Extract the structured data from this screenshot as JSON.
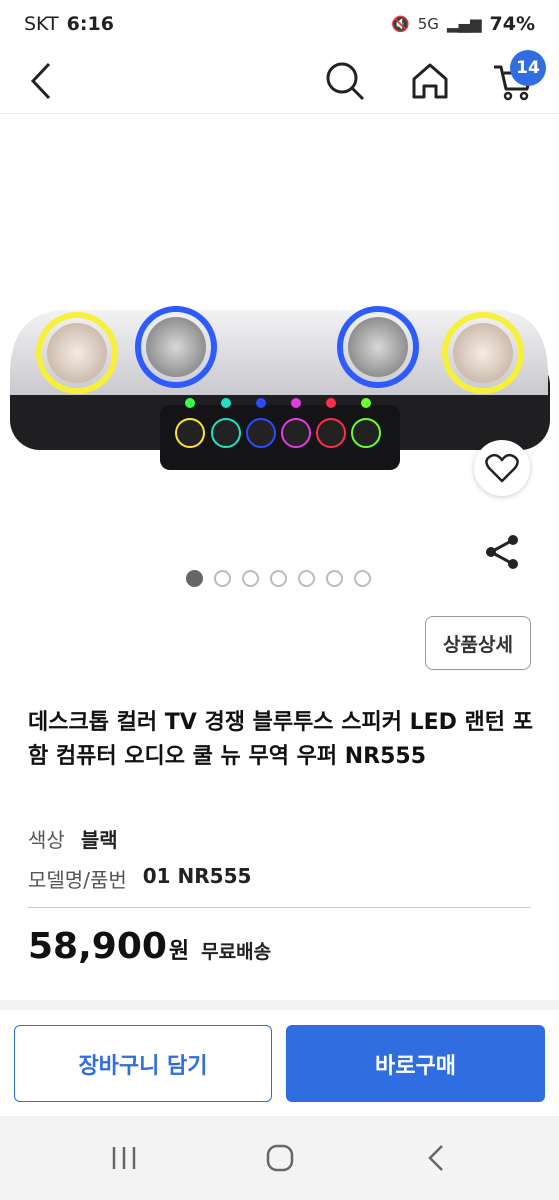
{
  "status": {
    "carrier": "SKT",
    "time": "6:16",
    "battery": "74%"
  },
  "nav": {
    "cart_count": "14"
  },
  "gallery": {
    "total": 7,
    "active": 0
  },
  "product": {
    "detail_button": "상품상세",
    "title": "데스크톱 컬러 TV 경쟁 블루투스 스피커 LED 랜턴 포함 컴퓨터 오디오 쿨 뉴 무역 우퍼 NR555",
    "specs": [
      {
        "key": "색상",
        "value": "블랙"
      },
      {
        "key": "모델명/품번",
        "value": "01 NR555"
      }
    ],
    "price": "58,900",
    "currency": "원",
    "shipping": "무료배송"
  },
  "actions": {
    "add_to_cart": "장바구니 담기",
    "buy_now": "바로구매"
  },
  "colors": {
    "accent": "#2f6de1"
  },
  "icons": [
    "back-icon",
    "search-icon",
    "home-icon",
    "cart-icon",
    "heart-icon",
    "share-icon"
  ]
}
